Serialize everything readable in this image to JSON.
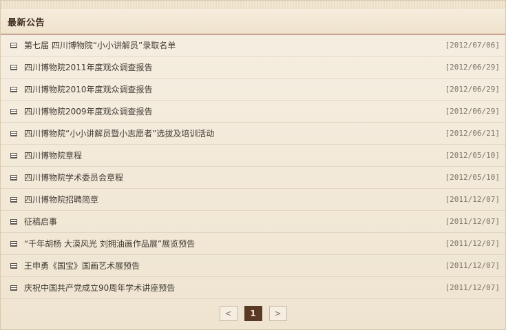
{
  "header": {
    "title": "最新公告"
  },
  "announcements": [
    {
      "title": "第七届 四川博物院“小小讲解员”录取名单",
      "date": "[2012/07/06]"
    },
    {
      "title": "四川博物院2011年度观众调查报告",
      "date": "[2012/06/29]"
    },
    {
      "title": "四川博物院2010年度观众调查报告",
      "date": "[2012/06/29]"
    },
    {
      "title": "四川博物院2009年度观众调查报告",
      "date": "[2012/06/29]"
    },
    {
      "title": "四川博物院“小小讲解员暨小志愿者”选拔及培训活动",
      "date": "[2012/06/21]"
    },
    {
      "title": "四川博物院章程",
      "date": "[2012/05/10]"
    },
    {
      "title": "四川博物院学术委员会章程",
      "date": "[2012/05/10]"
    },
    {
      "title": "四川博物院招聘简章",
      "date": "[2011/12/07]"
    },
    {
      "title": "征稿启事",
      "date": "[2011/12/07]"
    },
    {
      "title": "“千年胡杨 大漠风光 刘拥油画作品展”展览预告",
      "date": "[2011/12/07]"
    },
    {
      "title": "王申勇《国宝》国画艺术展预告",
      "date": "[2011/12/07]"
    },
    {
      "title": "庆祝中国共产党成立90周年学术讲座预告",
      "date": "[2011/12/07]"
    }
  ],
  "pagination": {
    "prev": "<",
    "current": "1",
    "next": ">"
  }
}
